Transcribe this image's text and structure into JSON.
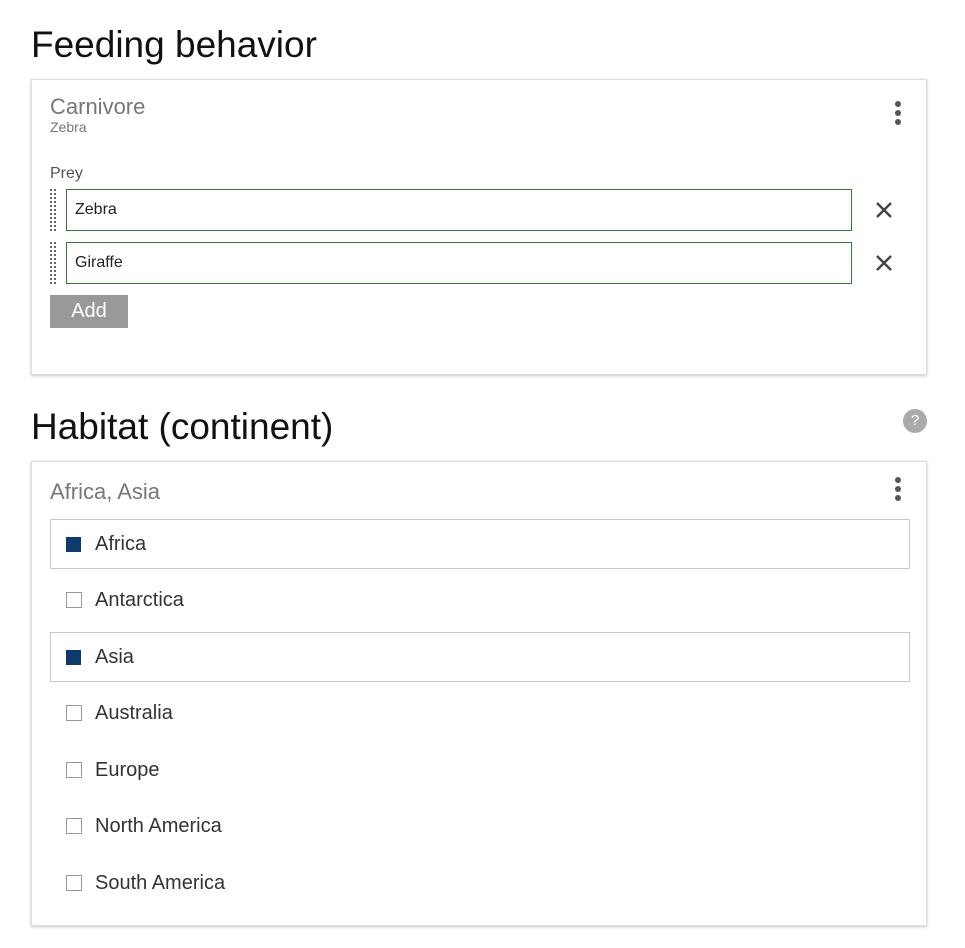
{
  "feeding": {
    "section_title": "Feeding behavior",
    "card_title": "Carnivore",
    "card_subtitle": "Zebra",
    "menu_icon": "kebab-menu-icon",
    "prey_label": "Prey",
    "prey": [
      {
        "value": "Zebra"
      },
      {
        "value": "Giraffe"
      }
    ],
    "remove_icon": "close-icon",
    "drag_icon": "drag-handle-icon",
    "add_label": "Add",
    "input_border_color": "#2e7d32"
  },
  "habitat": {
    "section_title": "Habitat (continent)",
    "help_label": "?",
    "card_title": "Africa, Asia",
    "menu_icon": "kebab-menu-icon",
    "checked_color": "#0d3b6e",
    "options": [
      {
        "label": "Africa",
        "checked": true
      },
      {
        "label": "Antarctica",
        "checked": false
      },
      {
        "label": "Asia",
        "checked": true
      },
      {
        "label": "Australia",
        "checked": false
      },
      {
        "label": "Europe",
        "checked": false
      },
      {
        "label": "North America",
        "checked": false
      },
      {
        "label": "South America",
        "checked": false
      }
    ]
  }
}
